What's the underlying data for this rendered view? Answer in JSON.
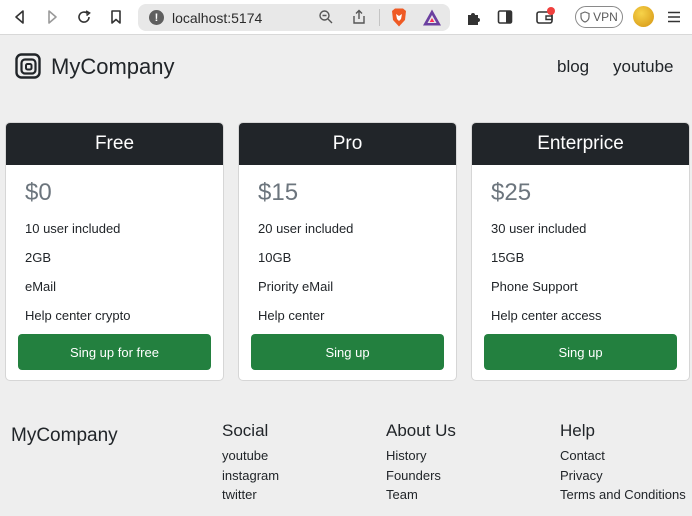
{
  "browser": {
    "url": "localhost:5174",
    "vpn_label": "VPN"
  },
  "header": {
    "brand": "MyCompany",
    "nav": [
      "blog",
      "youtube"
    ]
  },
  "plans": [
    {
      "name": "Free",
      "price": "$0",
      "features": [
        "10 user included",
        "2GB",
        "eMail",
        "Help center crypto"
      ],
      "button": "Sing up for free"
    },
    {
      "name": "Pro",
      "price": "$15",
      "features": [
        "20 user included",
        "10GB",
        "Priority eMail",
        "Help center"
      ],
      "button": "Sing up"
    },
    {
      "name": "Enterprice",
      "price": "$25",
      "features": [
        "30 user included",
        "15GB",
        "Phone Support",
        "Help center access"
      ],
      "button": "Sing up"
    }
  ],
  "footer": {
    "brand": "MyCompany",
    "columns": [
      {
        "title": "Social",
        "links": [
          "youtube",
          "instagram",
          "twitter"
        ]
      },
      {
        "title": "About Us",
        "links": [
          "History",
          "Founders",
          "Team"
        ]
      },
      {
        "title": "Help",
        "links": [
          "Contact",
          "Privacy",
          "Terms and Conditions"
        ]
      }
    ]
  },
  "colors": {
    "page_bg": "#eeeeee",
    "card_header": "#212529",
    "button": "#23803f",
    "price_text": "#6c757d"
  }
}
